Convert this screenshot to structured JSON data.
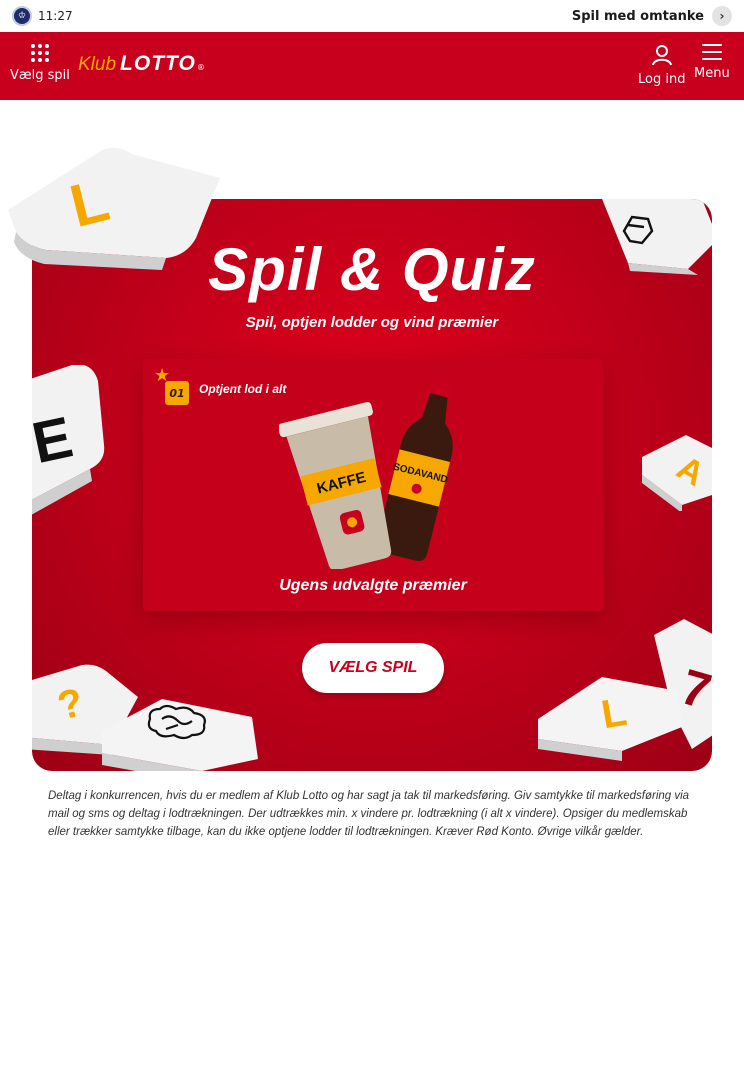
{
  "status": {
    "time": "11:27",
    "responsible_label": "Spil med omtanke"
  },
  "header": {
    "choose_label": "Vælg spil",
    "logo_klub": "Klub",
    "logo_lotto": "LOTTO",
    "logo_reg": "®",
    "login_label": "Log ind",
    "menu_label": "Menu"
  },
  "hero": {
    "title": "Spil & Quiz",
    "subtitle": "Spil, optjen lodder og vind præmier",
    "badge_count": "01",
    "earned_label": "Optjent lod i alt",
    "cup_label": "KAFFE",
    "bottle_label": "SODAVAND",
    "prize_caption": "Ugens udvalgte præmier",
    "cta_label": "VÆLG SPIL",
    "tile_letters": {
      "top_left": "L",
      "left": "E",
      "right": "A",
      "bottom_left": "?",
      "bottom_right": "L",
      "far_right": "7"
    }
  },
  "disclaimer": "Deltag i konkurrencen, hvis du er medlem af Klub Lotto og har sagt ja tak til markedsføring. Giv samtykke til markedsføring via mail og sms og deltag i lodtrækningen. Der udtrækkes min. x vindere pr. lodtrækning (i alt x vindere). Opsiger du medlemskab eller trækker samtykke tilbage, kan du ikke optjene lodder til lodtrækningen. Kræver Rød Konto. Øvrige vilkår gælder.",
  "colors": {
    "brand_red": "#c8001e",
    "accent_yellow": "#f7a800"
  }
}
